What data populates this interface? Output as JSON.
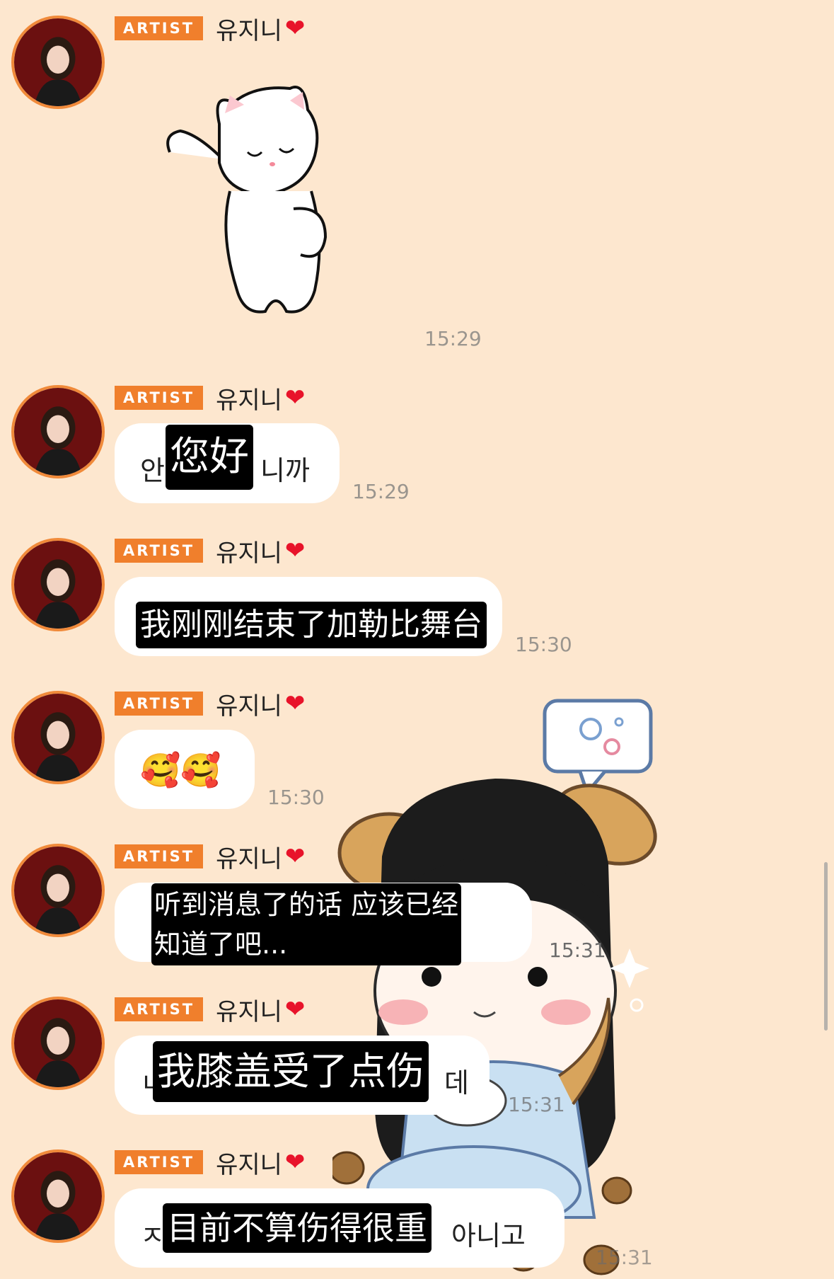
{
  "sender": {
    "badge": "ARTIST",
    "name": "유지니"
  },
  "messages": [
    {
      "type": "sticker",
      "sticker": "white-cat-waving",
      "time": "15:29"
    },
    {
      "type": "text",
      "original_visible": [
        "안",
        "니까"
      ],
      "subtitle": "您好",
      "time": "15:29"
    },
    {
      "type": "text",
      "subtitle": "我刚刚结束了加勒比舞台",
      "time": "15:30"
    },
    {
      "type": "text",
      "emojis": "🥰🥰",
      "time": "15:30"
    },
    {
      "type": "text",
      "subtitle_lines": [
        "听到消息了的话 应该已经",
        "知道了吧..."
      ],
      "time": "15:31"
    },
    {
      "type": "text",
      "original_visible": [
        "ㄴ",
        "데"
      ],
      "subtitle": "我膝盖受了点伤",
      "time": "15:31"
    },
    {
      "type": "text",
      "original_visible": [
        "ㅈ",
        "아니고"
      ],
      "subtitle": "目前不算伤得很重",
      "time": "15:31"
    }
  ],
  "overlay": {
    "sticker": "girl-with-puppy-ears-and-acorns"
  },
  "colors": {
    "background": "#fde7cf",
    "badge": "#f07f2c",
    "accent_ring": "#f08a3a",
    "heart": "#e8132a"
  }
}
